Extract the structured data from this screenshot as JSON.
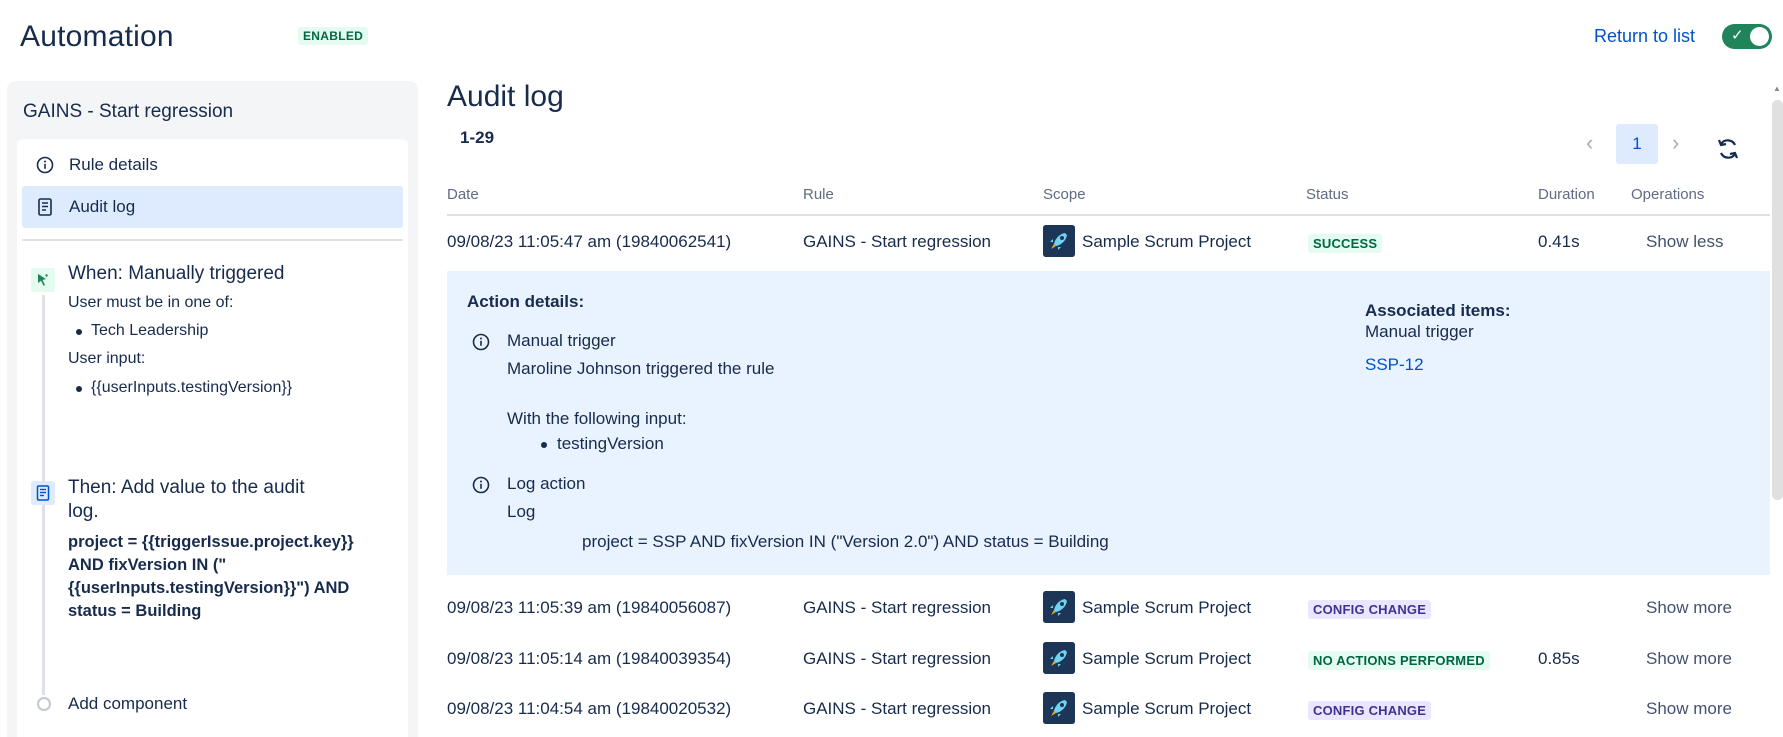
{
  "header": {
    "title": "Automation",
    "badge": "ENABLED",
    "return_link": "Return to list",
    "toggle_on": true
  },
  "sidebar": {
    "rule_name": "GAINS - Start regression",
    "nav": [
      {
        "label": "Rule details",
        "icon": "info-icon"
      },
      {
        "label": "Audit log",
        "icon": "document-icon",
        "active": true
      }
    ],
    "trigger": {
      "title": "When: Manually triggered",
      "condition": "User must be in one of:",
      "groups": [
        "Tech Leadership"
      ],
      "input_label": "User input:",
      "inputs": [
        "{{userInputs.testingVersion}}"
      ]
    },
    "action": {
      "title_line1": "Then: Add value to the audit",
      "title_line2": "log.",
      "value": "project = {{triggerIssue.project.key}} AND fixVersion IN (\"{{userInputs.testingVersion}}\") AND status = Building"
    },
    "add_component": "Add component"
  },
  "main": {
    "title": "Audit log",
    "range": "1-29",
    "page": "1",
    "columns": [
      "Date",
      "Rule",
      "Scope",
      "Status",
      "Duration",
      "Operations"
    ],
    "rows": [
      {
        "date": "09/08/23 11:05:47 am (19840062541)",
        "rule": "GAINS - Start regression",
        "scope": "Sample Scrum Project",
        "status": "SUCCESS",
        "duration": "0.41s",
        "operation": "Show less"
      },
      {
        "date": "09/08/23 11:05:39 am (19840056087)",
        "rule": "GAINS - Start regression",
        "scope": "Sample Scrum Project",
        "status": "CONFIG CHANGE",
        "duration": "",
        "operation": "Show more"
      },
      {
        "date": "09/08/23 11:05:14 am (19840039354)",
        "rule": "GAINS - Start regression",
        "scope": "Sample Scrum Project",
        "status": "NO ACTIONS PERFORMED",
        "duration": "0.85s",
        "operation": "Show more"
      },
      {
        "date": "09/08/23 11:04:54 am (19840020532)",
        "rule": "GAINS - Start regression",
        "scope": "Sample Scrum Project",
        "status": "CONFIG CHANGE",
        "duration": "",
        "operation": "Show more"
      }
    ],
    "details": {
      "heading": "Action details:",
      "trigger_title": "Manual trigger",
      "trigger_text": "Maroline Johnson triggered the rule",
      "input_intro": "With the following input:",
      "input_items": [
        "testingVersion"
      ],
      "log_title": "Log action",
      "log_label": "Log",
      "log_value": "project = SSP AND fixVersion IN (\"Version 2.0\") AND status = Building",
      "assoc_heading": "Associated items:",
      "assoc_sub": "Manual trigger",
      "assoc_link": "SSP-12"
    }
  }
}
